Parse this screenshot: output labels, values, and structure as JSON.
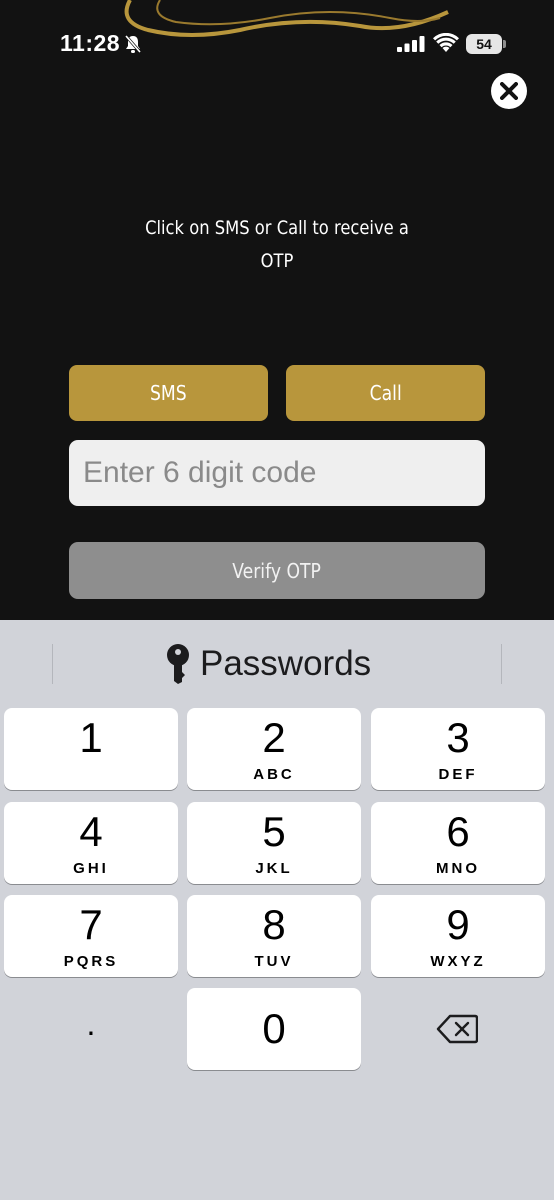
{
  "status_bar": {
    "time": "11:28",
    "battery_level": "54",
    "icons": [
      "bell-slash-icon",
      "cellular-signal-icon",
      "wifi-icon",
      "battery-icon"
    ]
  },
  "header": {
    "close_icon": "close-icon"
  },
  "instruction": {
    "line1": "Click on SMS or Call to receive a",
    "line2": "OTP"
  },
  "otp_options": {
    "sms_label": "SMS",
    "call_label": "Call"
  },
  "code_field": {
    "placeholder": "Enter 6 digit code",
    "value": ""
  },
  "verify_button": {
    "label": "Verify OTP"
  },
  "keyboard": {
    "suggestion_label": "Passwords",
    "suggestion_icon": "key-icon",
    "keys": [
      {
        "digit": "1",
        "letters": ""
      },
      {
        "digit": "2",
        "letters": "ABC"
      },
      {
        "digit": "3",
        "letters": "DEF"
      },
      {
        "digit": "4",
        "letters": "GHI"
      },
      {
        "digit": "5",
        "letters": "JKL"
      },
      {
        "digit": "6",
        "letters": "MNO"
      },
      {
        "digit": "7",
        "letters": "PQRS"
      },
      {
        "digit": "8",
        "letters": "TUV"
      },
      {
        "digit": "9",
        "letters": "WXYZ"
      }
    ],
    "bottom_row": {
      "dot": ".",
      "zero": "0",
      "backspace_icon": "backspace-icon"
    }
  },
  "colors": {
    "background": "#121212",
    "accent_gold": "#b8963c",
    "verify_gray": "#8e8e8e",
    "input_bg": "#efefef",
    "keyboard_bg": "#d1d3d9"
  }
}
